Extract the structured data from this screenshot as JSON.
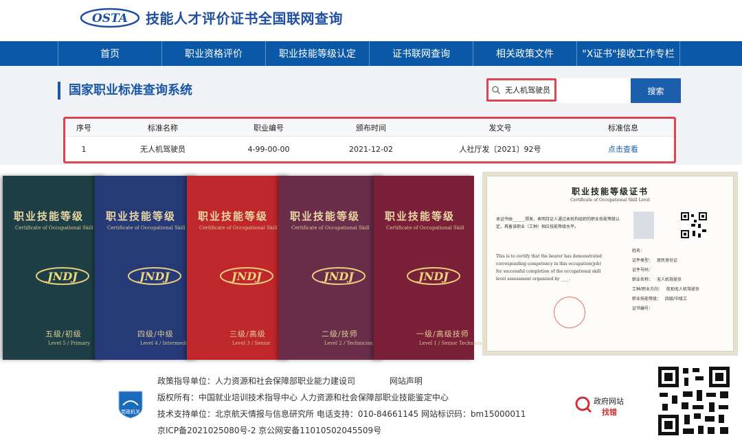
{
  "header": {
    "logo_text": "OSTA",
    "site_title": "技能人才评价证书全国联网查询"
  },
  "nav": {
    "items": [
      {
        "label": "首页"
      },
      {
        "label": "职业资格评价"
      },
      {
        "label": "职业技能等级认定"
      },
      {
        "label": "证书联网查询"
      },
      {
        "label": "相关政策文件"
      },
      {
        "label": "\"X证书\"接收工作专栏"
      }
    ]
  },
  "search": {
    "system_title": "国家职业标准查询系统",
    "query_value": "无人机驾驶员",
    "button_label": "搜索"
  },
  "table": {
    "headers": [
      "序号",
      "标准名称",
      "职业编号",
      "颁布时间",
      "发文号",
      "标准信息"
    ],
    "rows": [
      {
        "index": "1",
        "name": "无人机驾驶员",
        "code": "4-99-00-00",
        "date": "2021-12-02",
        "doc_no": "人社厅发〔2021〕92号",
        "link": "点击查看"
      }
    ]
  },
  "certificates": {
    "books": [
      {
        "title": "职业技能等级",
        "subtitle": "Certificate of Occupational Skill",
        "logo": "JNDJ",
        "level": "五级/初级",
        "level_en": "Level 5 / Primary"
      },
      {
        "title": "职业技能等级",
        "subtitle": "Certificate of Occupational Skill",
        "logo": "JNDJ",
        "level": "四级/中级",
        "level_en": "Level 4 / Intermediate"
      },
      {
        "title": "职业技能等级",
        "subtitle": "Certificate of Occupational Skill",
        "logo": "JNDJ",
        "level": "三级/高级",
        "level_en": "Level 3 / Senior"
      },
      {
        "title": "职业技能等级",
        "subtitle": "Certificate of Occupational Skill",
        "logo": "JNDJ",
        "level": "二级/技师",
        "level_en": "Level 2 / Technician"
      },
      {
        "title": "职业技能等级",
        "subtitle": "Certificate of Occupational Skill",
        "logo": "JNDJ",
        "level": "一级/高级技师",
        "level_en": "Level 1 / Senior Technician"
      }
    ],
    "book_colors": [
      "#1e3f46",
      "#263a78",
      "#c0272d",
      "#6a2e4a",
      "#7a2038"
    ],
    "paper": {
      "title": "职业技能等级证书",
      "subtitle": "Certificate of Occupational Skill Level",
      "cn_text": "本证书由______颁发，表明持证人通过本机构组织的职业技能等级认定，具备该职业（工种）相应技能等级水平。",
      "en_text": "This is to certify that the bearer has demonstrated corresponding competency in this occupation(job) for successful completion of the occupational skill level assessment organized by ____.",
      "fields": [
        "姓名",
        "证件类型",
        "证件号码",
        "职业名称",
        "工种/职业方向",
        "职业技能等级",
        "证书编号"
      ],
      "values": [
        "",
        "居民身份证",
        "",
        "无人机驾驶员",
        "航拍无人机驾驶员",
        "四级/中级工",
        ""
      ]
    }
  },
  "footer": {
    "line1_a": "政策指导单位：人力资源和社会保障部职业能力建设司",
    "line1_b": "网站声明",
    "line2": "版权所有：中国就业培训技术指导中心  人力资源和社会保障部职业技能鉴定中心",
    "line3": "技术支持单位：北京航天情报与信息研究所  电话支持：010-84661145  网站标识码：bm15000011",
    "line4": "京ICP备2021025080号-2  京公网安备11010502045509号",
    "badge_label": "党政机关",
    "gov_top": "政府网站",
    "gov_bottom": "找错"
  }
}
